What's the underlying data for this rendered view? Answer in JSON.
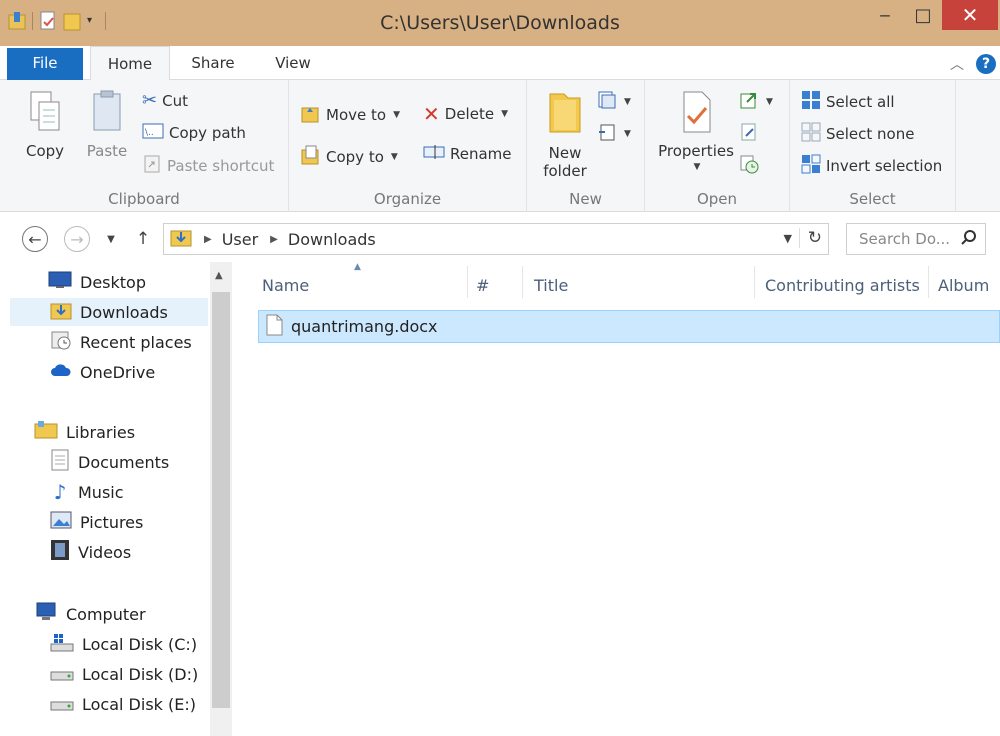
{
  "window": {
    "title": "C:\\Users\\User\\Downloads",
    "minimize_glyph": "‒",
    "maximize_glyph": "□",
    "close_glyph": "✕"
  },
  "ribbon_tabs": {
    "file": "File",
    "home": "Home",
    "share": "Share",
    "view": "View",
    "help": "?"
  },
  "ribbon": {
    "clipboard": {
      "label": "Clipboard",
      "copy": "Copy",
      "paste": "Paste",
      "cut": "Cut",
      "copy_path": "Copy path",
      "paste_shortcut": "Paste shortcut"
    },
    "organize": {
      "label": "Organize",
      "move_to": "Move to",
      "copy_to": "Copy to",
      "delete": "Delete",
      "rename": "Rename"
    },
    "new": {
      "label": "New",
      "new_folder_line1": "New",
      "new_folder_line2": "folder"
    },
    "open": {
      "label": "Open",
      "properties": "Properties"
    },
    "select": {
      "label": "Select",
      "select_all": "Select all",
      "select_none": "Select none",
      "invert_selection": "Invert selection"
    }
  },
  "address_bar": {
    "crumbs": [
      "User",
      "Downloads"
    ],
    "search_placeholder": "Search Do..."
  },
  "navigation_pane": {
    "favorites": [
      "Desktop",
      "Downloads",
      "Recent places"
    ],
    "onedrive": "OneDrive",
    "libraries": "Libraries",
    "library_items": [
      "Documents",
      "Music",
      "Pictures",
      "Videos"
    ],
    "computer": "Computer",
    "drives": [
      "Local Disk (C:)",
      "Local Disk (D:)",
      "Local Disk (E:)"
    ],
    "selected": "Downloads"
  },
  "file_list": {
    "columns": [
      "Name",
      "#",
      "Title",
      "Contributing artists",
      "Album"
    ],
    "files": [
      {
        "name": "quantrimang.docx",
        "selected": true
      }
    ]
  },
  "colors": {
    "titlebar": "#d7b184",
    "file_tab": "#1a6ec1",
    "close_button": "#c7423a",
    "selection": "#cce8ff"
  }
}
